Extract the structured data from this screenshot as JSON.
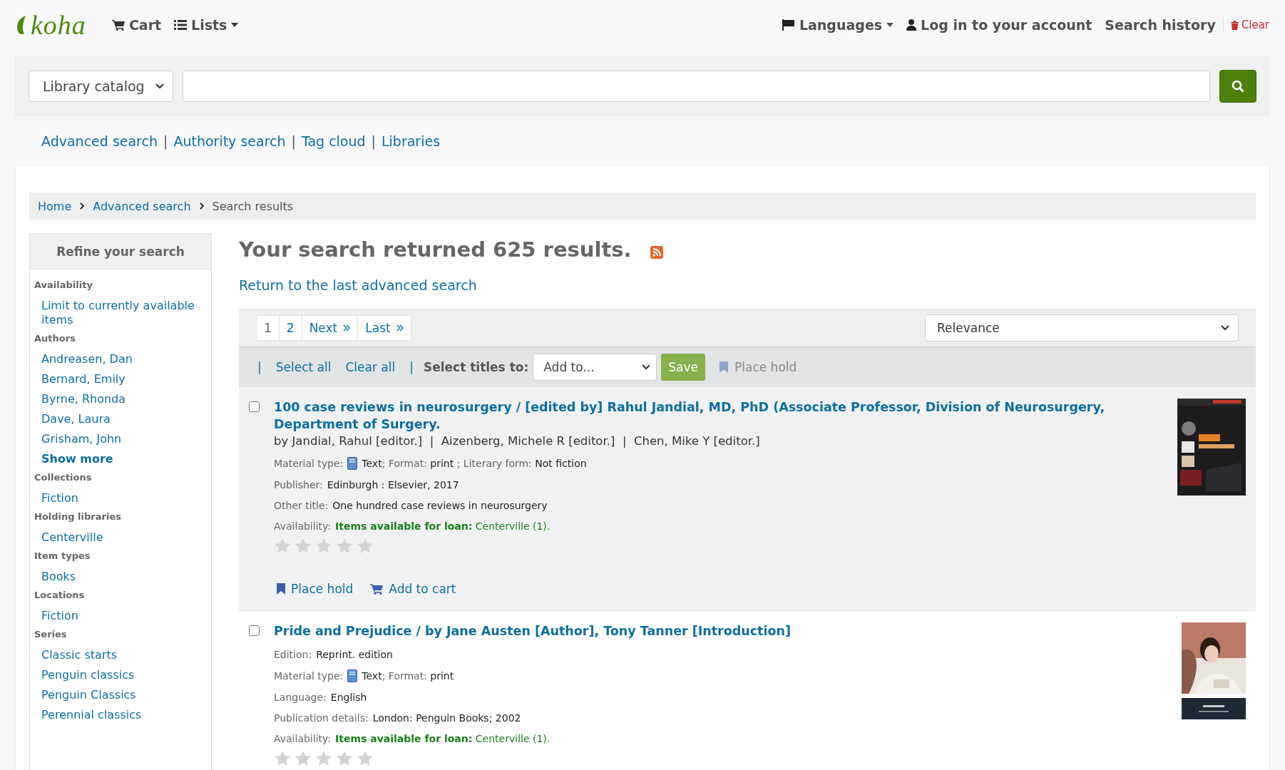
{
  "header": {
    "logo": "koha",
    "nav": [
      {
        "kind": "cart",
        "label": "Cart"
      },
      {
        "kind": "lists",
        "label": "Lists"
      }
    ],
    "languages": "Languages",
    "login": "Log in to your account",
    "search_history": "Search history",
    "clear": "Clear"
  },
  "search": {
    "scope": "Library catalog"
  },
  "links": {
    "separator": "|",
    "items": [
      "Advanced search",
      "Authority search",
      "Tag cloud",
      "Libraries"
    ]
  },
  "breadcrumb": [
    {
      "label": "Home",
      "current": false
    },
    {
      "label": "Advanced search",
      "current": false
    },
    {
      "label": "Search results",
      "current": true
    }
  ],
  "sidebar": {
    "title": "Refine your search",
    "facets": [
      {
        "heading": "Availability",
        "items": [
          "Limit to currently available items"
        ]
      },
      {
        "heading": "Authors",
        "items": [
          "Andreasen, Dan",
          "Bernard, Emily",
          "Byrne, Rhonda",
          "Dave, Laura",
          "Grisham, John"
        ],
        "show_more": "Show more"
      },
      {
        "heading": "Collections",
        "items": [
          "Fiction"
        ]
      },
      {
        "heading": "Holding libraries",
        "items": [
          "Centerville"
        ]
      },
      {
        "heading": "Item types",
        "items": [
          "Books"
        ]
      },
      {
        "heading": "Locations",
        "items": [
          "Fiction"
        ]
      },
      {
        "heading": "Series",
        "items": [
          "Classic starts",
          "Penguin classics",
          "Penguin Classics",
          "Perennial classics"
        ]
      }
    ]
  },
  "results_heading": "Your search returned 625 results.",
  "return_link": "Return to the last advanced search",
  "pagination": {
    "pages": [
      {
        "label": "1",
        "selected": true
      },
      {
        "label": "2",
        "selected": false
      }
    ],
    "next": "Next",
    "last": "Last"
  },
  "sort": "Relevance",
  "toolbar": {
    "separator": "|",
    "select_all": "Select all",
    "clear_all": "Clear all",
    "select_titles_label": "Select titles to:",
    "add_to": "Add to...",
    "save": "Save",
    "place_hold": "Place hold",
    "place_hold_disabled": true
  },
  "results": [
    {
      "checked": false,
      "highlighted": true,
      "title": "100 case reviews in neurosurgery / [edited by] Rahul Jandial, MD, PhD (Associate Professor, Division of Neurosurgery, Department of Surgery.",
      "authors": "by Jandial, Rahul [editor.]  |  Aizenberg, Michele R [editor.]  |  Chen, Mike Y [editor.]",
      "lines": [
        {
          "kind": "material",
          "label": "Material type:",
          "parts": [
            {
              "text": "Text",
              "muted": false
            },
            {
              "text": "; Format: ",
              "muted": true
            },
            {
              "text": "print",
              "muted": false
            },
            {
              "text": " ; Literary form: ",
              "muted": true
            },
            {
              "text": "Not fiction",
              "muted": false
            }
          ]
        },
        {
          "kind": "plain",
          "label": "Publisher:",
          "value": "Edinburgh : Elsevier, 2017"
        },
        {
          "kind": "plain",
          "label": "Other title:",
          "value": "One hundred case reviews in neurosurgery"
        },
        {
          "kind": "availability",
          "label": "Availability:",
          "value": "**Items available for loan:** Centerville (1)."
        }
      ],
      "stars": 0,
      "actions": [
        {
          "kind": "hold",
          "label": "Place hold"
        },
        {
          "kind": "cart",
          "label": "Add to cart"
        }
      ]
    },
    {
      "checked": false,
      "highlighted": false,
      "title": "Pride and Prejudice / by Jane Austen [Author], Tony Tanner [Introduction]",
      "lines": [
        {
          "kind": "plain",
          "label": "Edition:",
          "value": "Reprint. edition"
        },
        {
          "kind": "material",
          "label": "Material type:",
          "parts": [
            {
              "text": "Text",
              "muted": false
            },
            {
              "text": "; Format: ",
              "muted": true
            },
            {
              "text": "print",
              "muted": false
            }
          ]
        },
        {
          "kind": "plain",
          "label": "Language:",
          "value": "English"
        },
        {
          "kind": "plain",
          "label": "Publication details:",
          "value": "London: Penguin Books; 2002"
        },
        {
          "kind": "availability",
          "label": "Availability:",
          "value": "**Items available for loan:** Centerville (1)."
        }
      ],
      "stars": 0
    }
  ]
}
